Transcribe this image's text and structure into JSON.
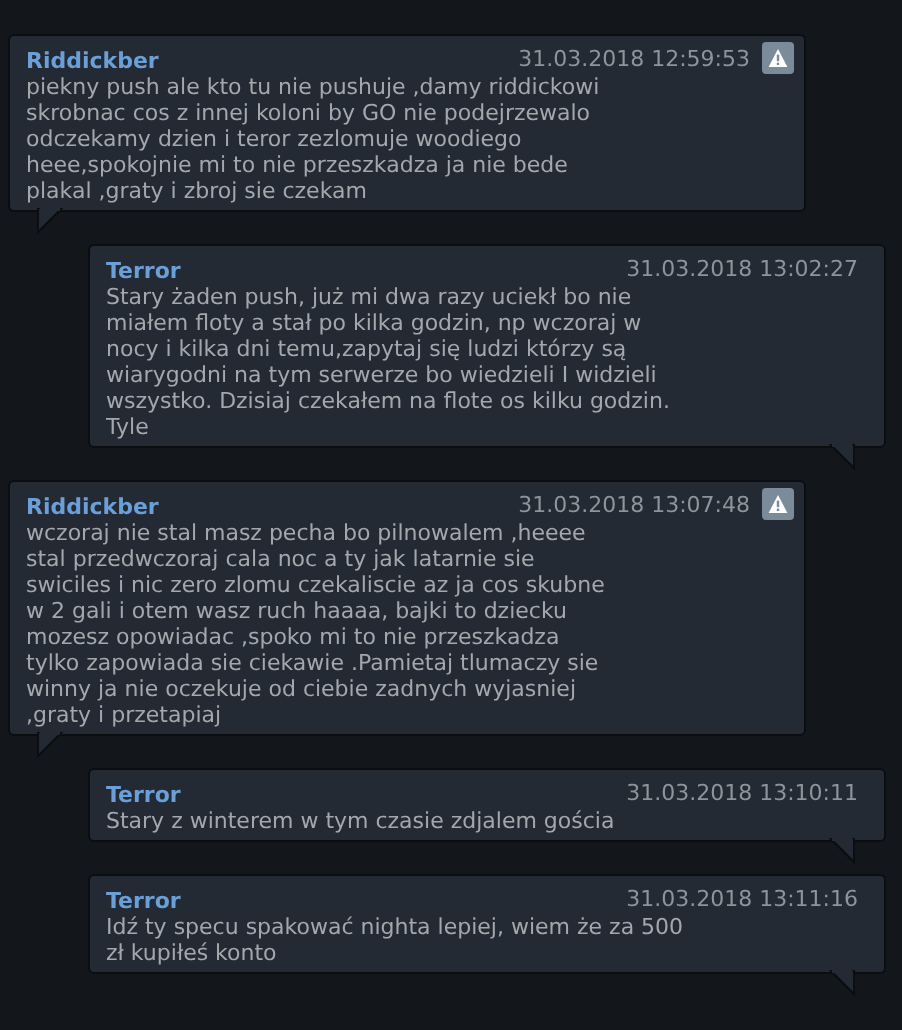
{
  "messages": [
    {
      "kind": "incoming",
      "author": "Riddickber",
      "time": "31.03.2018 12:59:53",
      "reportable": true,
      "text": "piekny push ale kto tu nie pushuje ,damy riddickowi skrobnac cos z innej koloni by GO nie podejrzewalo odczekamy dzien i teror zezlomuje woodiego heee,spokojnie mi to nie przeszkadza ja nie bede plakal ,graty i zbroj sie czekam"
    },
    {
      "kind": "outgoing",
      "author": "Terror",
      "time": "31.03.2018 13:02:27",
      "reportable": false,
      "text": "Stary żaden push, już mi dwa razy uciekł bo nie miałem floty a stał po kilka godzin, np wczoraj w nocy i kilka dni temu,zapytaj się ludzi którzy są wiarygodni na tym serwerze bo wiedzieli I widzieli wszystko. Dzisiaj czekałem na flote os kilku godzin. Tyle"
    },
    {
      "kind": "incoming",
      "author": "Riddickber",
      "time": "31.03.2018 13:07:48",
      "reportable": true,
      "text": "wczoraj nie stal masz pecha bo pilnowalem ,heeee stal przedwczoraj cala noc a ty jak latarnie sie swiciles i nic zero zlomu czekaliscie az ja cos skubne w 2 gali i otem wasz ruch haaaa, bajki to dziecku mozesz opowiadac ,spoko mi to nie przeszkadza tylko zapowiada sie ciekawie .Pamietaj tlumaczy sie winny ja nie oczekuje od ciebie zadnych wyjasniej ,graty i przetapiaj"
    },
    {
      "kind": "outgoing",
      "author": "Terror",
      "time": "31.03.2018 13:10:11",
      "reportable": false,
      "text": "Stary z winterem w tym czasie zdjalem gościa"
    },
    {
      "kind": "outgoing",
      "author": "Terror",
      "time": "31.03.2018 13:11:16",
      "reportable": false,
      "text": "Idź ty specu spakować nighta lepiej, wiem że za 500 zł kupiłeś konto"
    }
  ]
}
